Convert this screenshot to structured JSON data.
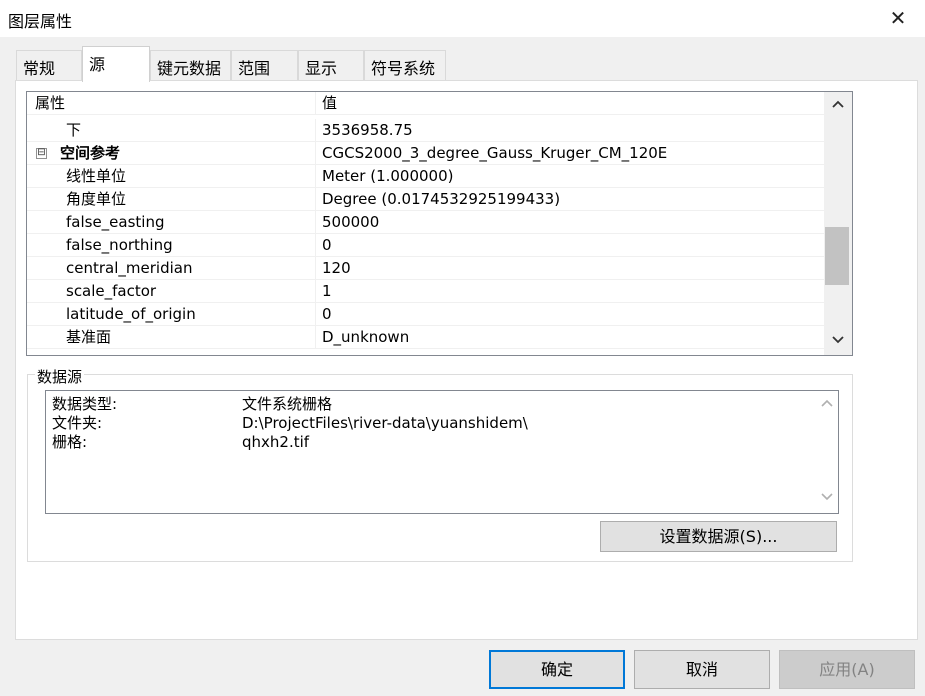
{
  "window": {
    "title": "图层属性",
    "close_glyph": "✕"
  },
  "tabs": [
    {
      "label": "常规",
      "active": false
    },
    {
      "label": "源",
      "active": true
    },
    {
      "label": "键元数据",
      "active": false
    },
    {
      "label": "范围",
      "active": false
    },
    {
      "label": "显示",
      "active": false
    },
    {
      "label": "符号系统",
      "active": false
    }
  ],
  "property_grid": {
    "header": {
      "property": "属性",
      "value": "值"
    },
    "rows": [
      {
        "property": "下",
        "value": "3536958.75"
      },
      {
        "property": "空间参考",
        "value": "CGCS2000_3_degree_Gauss_Kruger_CM_120E",
        "section": true,
        "expander": "⊟"
      },
      {
        "property": "线性单位",
        "value": "Meter (1.000000)"
      },
      {
        "property": "角度单位",
        "value": "Degree (0.0174532925199433)"
      },
      {
        "property": "false_easting",
        "value": "500000"
      },
      {
        "property": "false_northing",
        "value": "0"
      },
      {
        "property": "central_meridian",
        "value": "120"
      },
      {
        "property": "scale_factor",
        "value": "1"
      },
      {
        "property": "latitude_of_origin",
        "value": "0"
      },
      {
        "property": "基准面",
        "value": "D_unknown"
      }
    ],
    "scroll_up_icon": "chevron-up-icon",
    "scroll_down_icon": "chevron-down-icon"
  },
  "data_source": {
    "group_label": "数据源",
    "lines": [
      {
        "key": "数据类型:",
        "value": "文件系统栅格"
      },
      {
        "key": "文件夹:",
        "value": "D:\\ProjectFiles\\river-data\\yuanshidem\\"
      },
      {
        "key": "栅格:",
        "value": "qhxh2.tif"
      }
    ],
    "set_source_button": "设置数据源(S)..."
  },
  "footer": {
    "ok": "确定",
    "cancel": "取消",
    "apply": "应用(A)"
  },
  "colors": {
    "accent": "#0078d7",
    "window_bg": "#f0f0f0",
    "panel_bg": "#ffffff"
  }
}
